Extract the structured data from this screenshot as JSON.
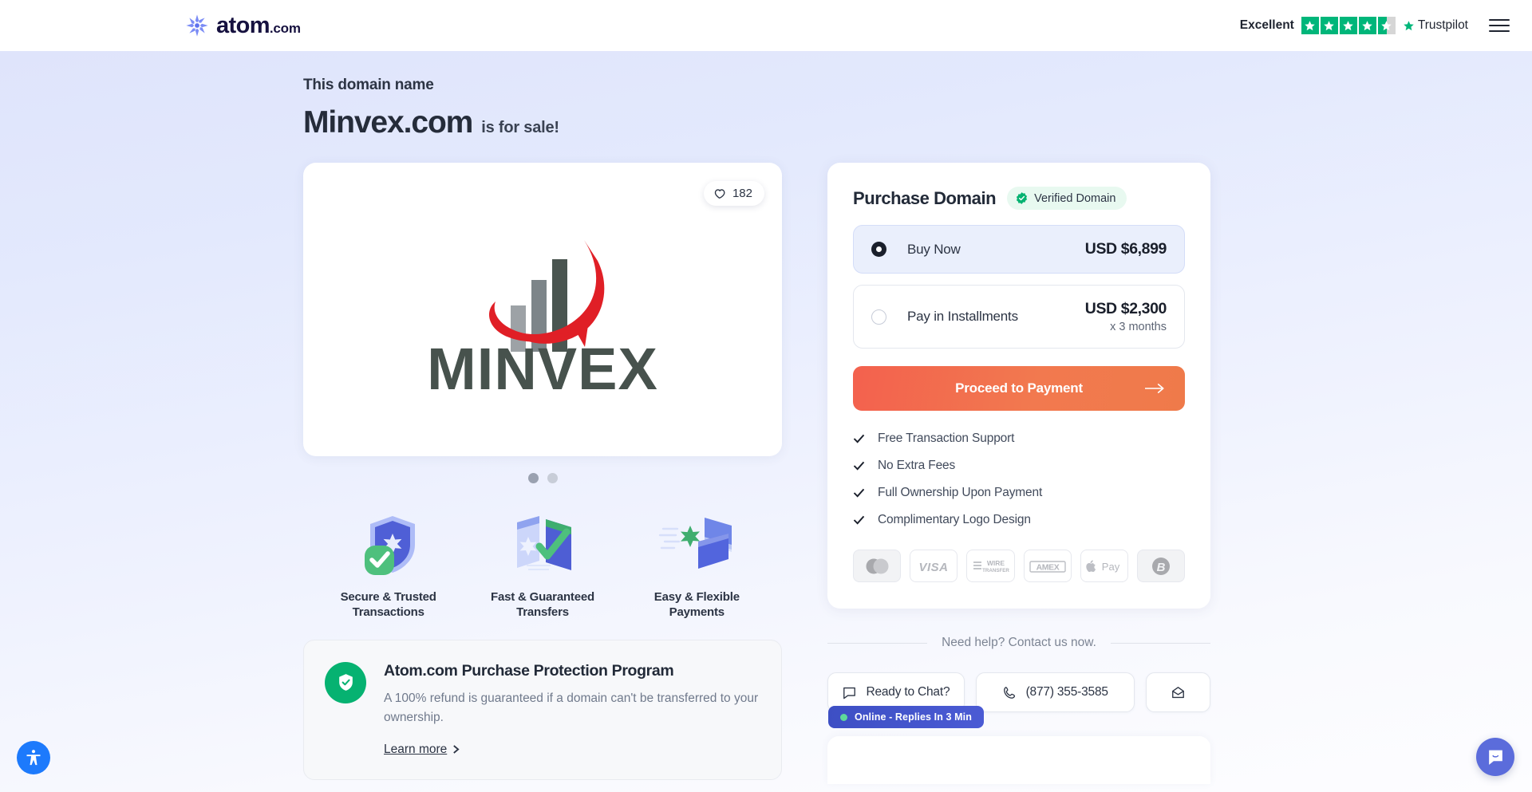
{
  "header": {
    "brand": "atom",
    "brand_suffix": ".com",
    "trustpilot": {
      "rating_word": "Excellent",
      "brand": "Trustpilot",
      "stars_full": 4,
      "stars_half": 1
    },
    "menu_label": "Menu"
  },
  "hero": {
    "kicker": "This domain name",
    "domain": "Minvex.com",
    "for_sale": "is for sale!"
  },
  "preview": {
    "likes": "182",
    "logo_text": "MINVEX",
    "dots": 2,
    "active_dot": 0
  },
  "features": [
    {
      "label": "Secure & Trusted Transactions",
      "icon": "shield-check-icon"
    },
    {
      "label": "Fast & Guaranteed Transfers",
      "icon": "transfer-windows-icon"
    },
    {
      "label": "Easy & Flexible Payments",
      "icon": "credit-cards-icon"
    }
  ],
  "protection": {
    "title": "Atom.com Purchase Protection Program",
    "body": "A 100% refund is guaranteed if a domain can't be transferred to your ownership.",
    "link": "Learn more"
  },
  "purchase": {
    "title": "Purchase Domain",
    "verified_label": "Verified Domain",
    "options": [
      {
        "label": "Buy Now",
        "price": "USD $6,899",
        "sub": "",
        "selected": true
      },
      {
        "label": "Pay in Installments",
        "price": "USD $2,300",
        "sub": "x 3 months",
        "selected": false
      }
    ],
    "cta": "Proceed to Payment",
    "bullets": [
      "Free Transaction Support",
      "No Extra Fees",
      "Full Ownership Upon Payment",
      "Complimentary Logo Design"
    ],
    "payment_methods": [
      "mastercard",
      "VISA",
      "WIRE TRANSFER",
      "AMEX",
      "Apple Pay",
      "bitcoin"
    ]
  },
  "contact": {
    "heading": "Need help? Contact us now.",
    "chat_label": "Ready to Chat?",
    "phone_label": "(877) 355-3585",
    "email_label": "Email us",
    "online_badge": "Online - Replies In 3 Min"
  },
  "floating": {
    "accessibility_label": "Accessibility",
    "chat_label": "Open chat"
  },
  "colors": {
    "accent_orange": "#f2794f",
    "trustpilot_green": "#00b67a",
    "protection_green": "#06b271",
    "hero_gradient_start": "#dfe4fb",
    "hero_gradient_end": "#fdfdff",
    "selected_option_bg": "#eaeffc",
    "online_badge": "#4b5bd4"
  }
}
